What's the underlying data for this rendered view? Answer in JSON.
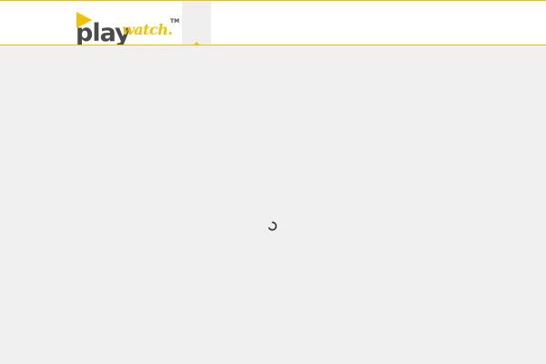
{
  "header": {
    "logo": {
      "word_play": "play",
      "word_watch": "watch.",
      "trademark": "TM",
      "accent_color": "#f2c200",
      "text_color": "#4a4a4a"
    },
    "nav_tab": {
      "icon": "caret-up-icon"
    }
  },
  "main": {
    "state": "loading",
    "loading_icon": "spinner-icon"
  },
  "colors": {
    "accent": "#f2c200",
    "header_background": "#ffffff",
    "page_background": "#f0f0f0"
  }
}
